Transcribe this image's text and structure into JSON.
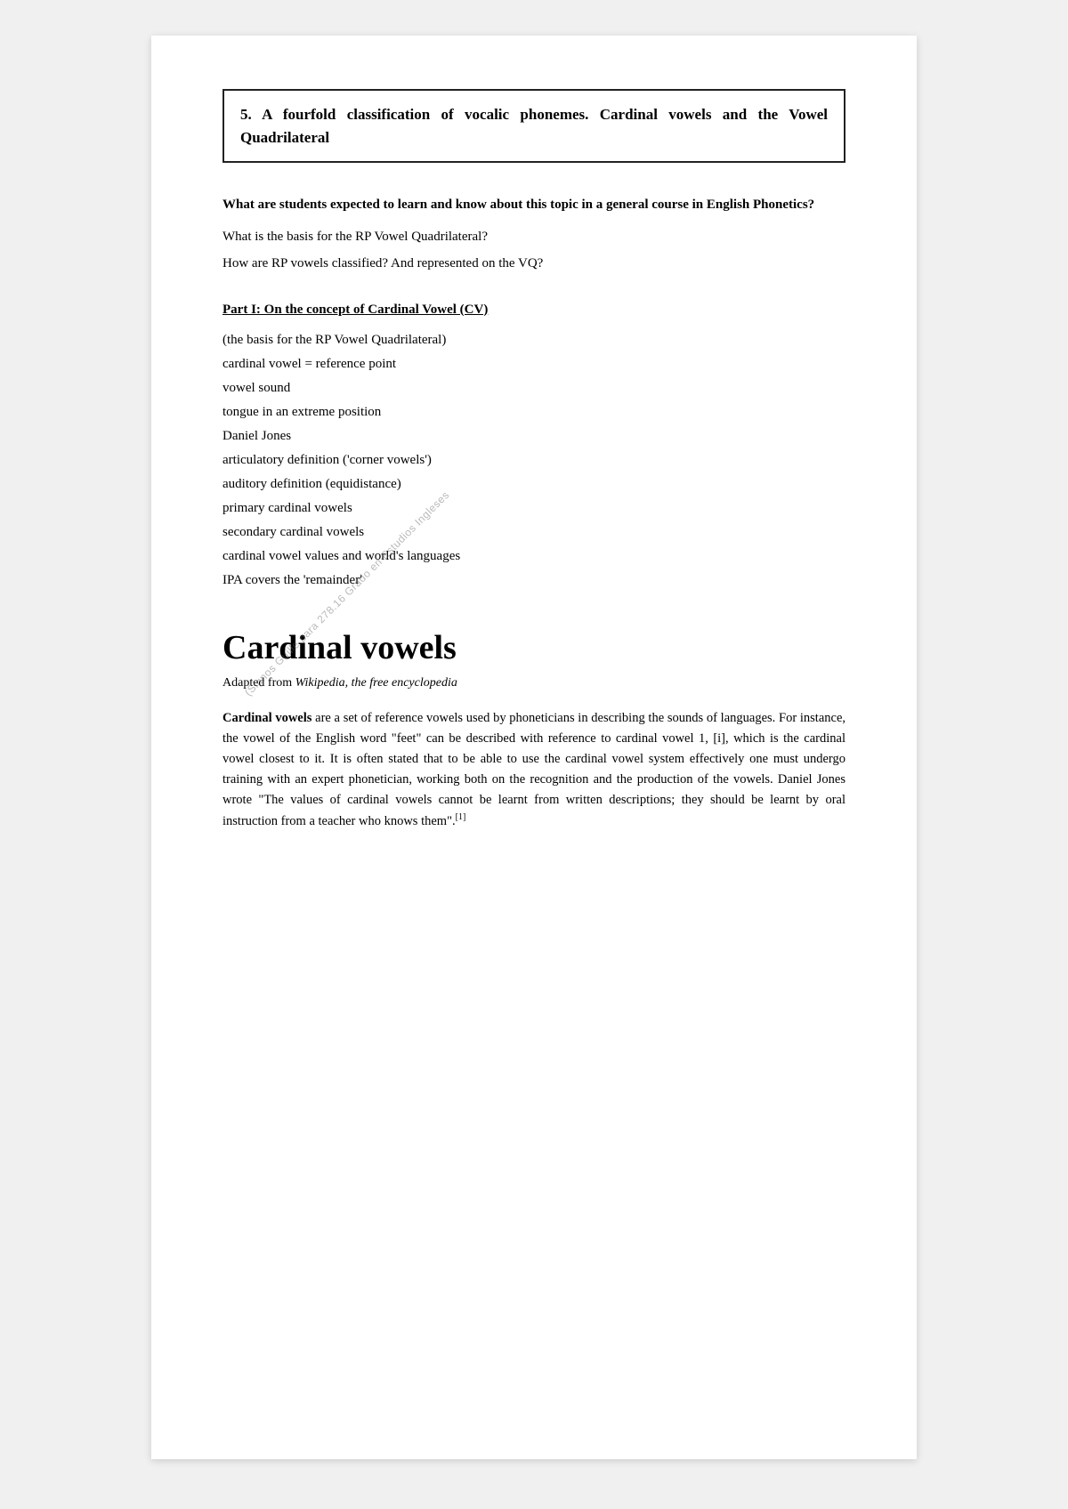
{
  "page": {
    "title_box": {
      "text": "5.  A fourfold classification of vocalic phonemes.  Cardinal vowels and the Vowel Quadrilateral"
    },
    "section_questions": {
      "bold_question": "What are students expected to learn and know about this topic in a general course in English Phonetics?",
      "q1": "What is the basis for the RP Vowel Quadrilateral?",
      "q2": "How are RP vowels classified? And represented on the VQ?"
    },
    "part_section": {
      "title": "Part I: On the concept of Cardinal Vowel (CV)",
      "items": [
        "(the basis for the RP Vowel Quadrilateral)",
        "cardinal vowel = reference point",
        "vowel sound",
        "tongue in an extreme position",
        "Daniel Jones",
        "articulatory definition ('corner vowels')",
        "auditory definition (equidistance)",
        "primary cardinal vowels",
        "secondary cardinal vowels",
        "cardinal vowel values and world's languages",
        "IPA covers the 'remainder'"
      ]
    },
    "cardinal_vowels": {
      "heading": "Cardinal vowels",
      "adapted_from_prefix": "Adapted from ",
      "adapted_from_italic": "Wikipedia, the free encyclopedia",
      "body": "Cardinal vowels are a set of reference vowels used by phoneticians in describing the sounds of languages. For instance, the vowel of the English word \"feet\" can be described with reference to cardinal vowel 1, [i], which is the cardinal vowel closest to it. It is often stated that to be able to use the cardinal vowel system effectively one must undergo training with an expert phonetician, working both on the recognition and the production of the vowels. Daniel Jones wrote \"The values of cardinal vowels cannot be learnt from written descriptions; they should be learnt by oral instruction from a teacher who knows them\".",
      "footnote": "[1]",
      "body_bold_start": "Cardinal vowels"
    },
    "watermark": {
      "text1": "(Signos Guille para 278.16 Grado en Estudios Ingleses"
    }
  }
}
